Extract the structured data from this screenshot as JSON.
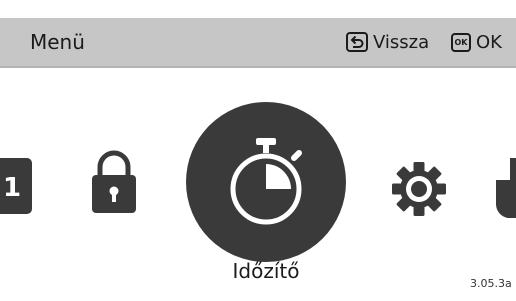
{
  "header": {
    "title": "Menü",
    "back_label": "Vissza",
    "ok_key_label": "OK",
    "ok_label": "OK"
  },
  "carousel": {
    "items": [
      {
        "icon": "number-1-icon",
        "label": "1"
      },
      {
        "icon": "lock-icon"
      },
      {
        "icon": "stopwatch-icon",
        "selected": true
      },
      {
        "icon": "gear-icon"
      },
      {
        "icon": "plug-icon"
      }
    ],
    "selected_label": "Időzítő"
  },
  "version": "3.05.3a",
  "colors": {
    "header_bg": "#c6c6c6",
    "icon_dark": "#3a3a3a",
    "text": "#1b1b1b",
    "background": "#ffffff"
  }
}
